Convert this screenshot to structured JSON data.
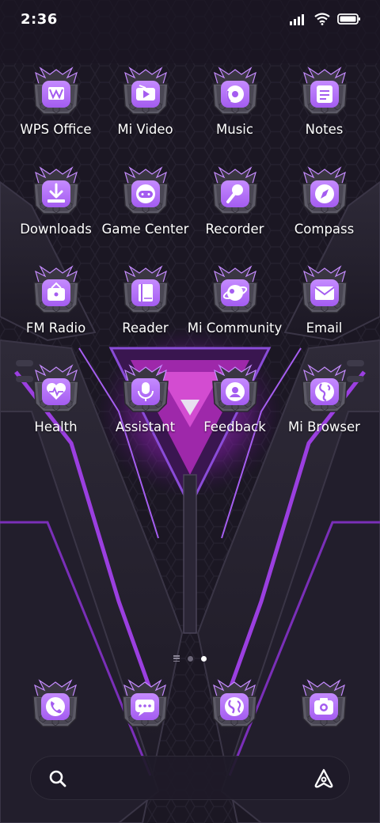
{
  "status_bar": {
    "time": "2:36",
    "icons": [
      "signal-icon",
      "wifi-icon",
      "battery-icon"
    ]
  },
  "theme": {
    "accent": "#a45cf0",
    "accent_light": "#c58bff",
    "background": "#1a1622",
    "icon_frame": "#5c5a66"
  },
  "apps": [
    {
      "label": "WPS Office",
      "icon": "wps-office-icon"
    },
    {
      "label": "Mi Video",
      "icon": "video-icon"
    },
    {
      "label": "Music",
      "icon": "music-icon"
    },
    {
      "label": "Notes",
      "icon": "notes-icon"
    },
    {
      "label": "Downloads",
      "icon": "download-icon"
    },
    {
      "label": "Game Center",
      "icon": "gamepad-icon"
    },
    {
      "label": "Recorder",
      "icon": "microphone-icon"
    },
    {
      "label": "Compass",
      "icon": "compass-icon"
    },
    {
      "label": "FM Radio",
      "icon": "radio-icon"
    },
    {
      "label": "Reader",
      "icon": "book-icon"
    },
    {
      "label": "Mi Community",
      "icon": "planet-icon"
    },
    {
      "label": "Email",
      "icon": "mail-icon"
    },
    {
      "label": "Health",
      "icon": "heart-pulse-icon"
    },
    {
      "label": "Assistant",
      "icon": "assistant-mic-icon"
    },
    {
      "label": "Feedback",
      "icon": "feedback-icon"
    },
    {
      "label": "Mi Browser",
      "icon": "globe-icon"
    }
  ],
  "page_indicator": {
    "pages": 2,
    "current_page": 2
  },
  "dock": [
    {
      "icon": "phone-icon"
    },
    {
      "icon": "messages-icon"
    },
    {
      "icon": "browser-globe-icon"
    },
    {
      "icon": "camera-icon"
    }
  ],
  "search_bar": {
    "icons": [
      "search-icon",
      "assistant-icon"
    ]
  }
}
